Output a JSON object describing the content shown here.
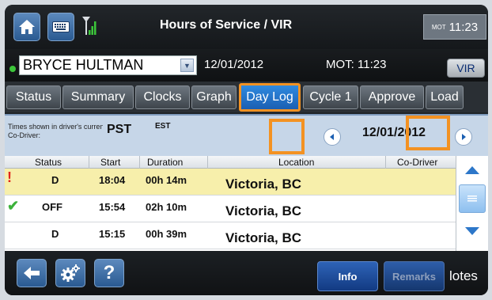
{
  "header": {
    "title": "Hours of Service / VIR",
    "clock_tz": "MOT",
    "clock_time": "11:23",
    "icons": [
      "home-icon",
      "keyboard-icon",
      "signal-icon"
    ]
  },
  "driver_bar": {
    "driver_name": "BRYCE HULTMAN",
    "date": "12/01/2012",
    "mot_time": "MOT: 11:23",
    "vir_label": "VIR"
  },
  "tabs": [
    {
      "label": "Status"
    },
    {
      "label": "Summary"
    },
    {
      "label": "Clocks"
    },
    {
      "label": "Graph"
    },
    {
      "label": "Day Log",
      "active": true
    },
    {
      "label": "Cycle 1"
    },
    {
      "label": "Approve"
    },
    {
      "label": "Load"
    }
  ],
  "info": {
    "times_note": "Times shown in driver's current tir",
    "codriver_label": "Co-Driver:",
    "tz_primary": "PST",
    "tz_secondary": "EST",
    "date": "12/01/2012"
  },
  "table": {
    "columns": [
      "Status",
      "Start",
      "Duration",
      "Location",
      "Co-Driver"
    ],
    "rows": [
      {
        "icon": "!",
        "status": "D",
        "start": "18:04",
        "duration": "00h 14m",
        "location": "Victoria, BC",
        "co_driver": ""
      },
      {
        "icon": "✔",
        "status": "OFF",
        "start": "15:54",
        "duration": "02h 10m",
        "location": "Victoria, BC",
        "co_driver": ""
      },
      {
        "icon": "",
        "status": "D",
        "start": "15:15",
        "duration": "00h 39m",
        "location": "Victoria, BC",
        "co_driver": ""
      }
    ]
  },
  "bottom": {
    "help_label": "?",
    "info_label": "Info",
    "remarks_label": "Remarks",
    "notes_label": "lotes"
  },
  "colors": {
    "accent_blue": "#1b5fb2",
    "highlight_orange": "#f39222",
    "selected_row": "#f7efab",
    "warning_red": "#e0241b",
    "check_green": "#3cb23a"
  }
}
